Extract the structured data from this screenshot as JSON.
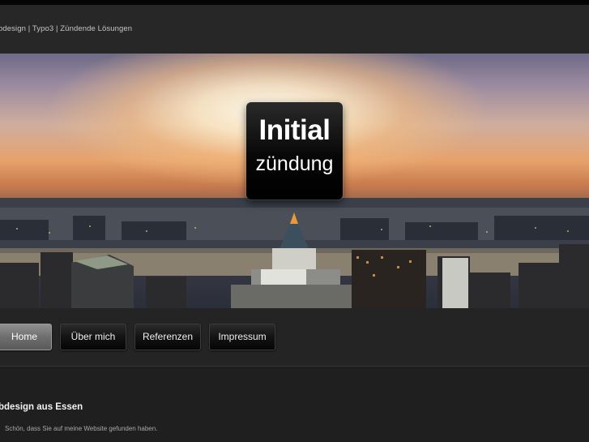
{
  "header": {
    "tagline": "bdesign | Typo3 | Zündende Lösungen"
  },
  "banner": {
    "logo_line1": "Initial",
    "logo_line2": "zündung"
  },
  "nav": {
    "items": [
      {
        "label": "Home",
        "active": true
      },
      {
        "label": "Über mich",
        "active": false
      },
      {
        "label": "Referenzen",
        "active": false
      },
      {
        "label": "Impressum",
        "active": false
      }
    ]
  },
  "content": {
    "heading": "bdesign aus Essen",
    "intro": "Schön, dass Sie auf meine Website gefunden haben."
  },
  "colors": {
    "background": "#1e1e1e",
    "header": "#272727",
    "active_button": "#7a7a7a"
  }
}
